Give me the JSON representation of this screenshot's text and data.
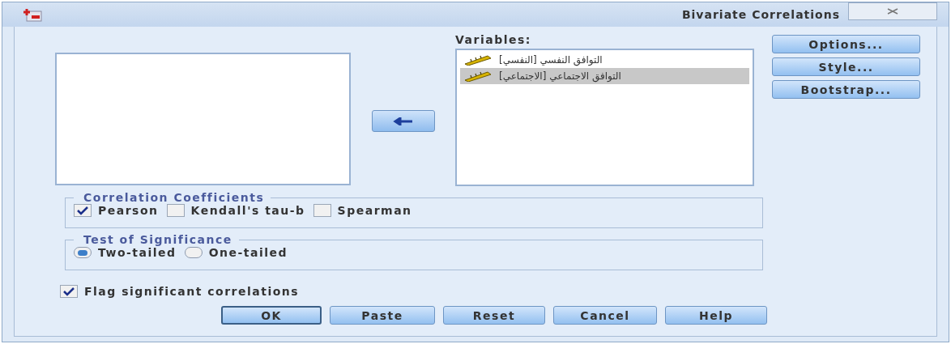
{
  "window": {
    "title": "Bivariate Correlations"
  },
  "variables": {
    "label": "Variables:",
    "items": [
      {
        "label": "التوافق النفسي [النفسي]",
        "selected": false
      },
      {
        "label": "التوافق الاجتماعي [الاجتماعي]",
        "selected": true
      }
    ]
  },
  "side_buttons": [
    "Options...",
    "Style...",
    "Bootstrap..."
  ],
  "correlation_coefficients": {
    "title": "Correlation Coefficients",
    "options": [
      {
        "label": "Pearson",
        "checked": true
      },
      {
        "label": "Kendall's tau-b",
        "checked": false
      },
      {
        "label": "Spearman",
        "checked": false
      }
    ]
  },
  "test_of_significance": {
    "title": "Test of Significance",
    "options": [
      {
        "label": "Two-tailed",
        "selected": true
      },
      {
        "label": "One-tailed",
        "selected": false
      }
    ]
  },
  "flag": {
    "label": "Flag significant correlations",
    "checked": true
  },
  "buttons": [
    {
      "label": "OK",
      "default": true
    },
    {
      "label": "Paste",
      "default": false
    },
    {
      "label": "Reset",
      "default": false
    },
    {
      "label": "Cancel",
      "default": false
    },
    {
      "label": "Help",
      "default": false
    }
  ]
}
